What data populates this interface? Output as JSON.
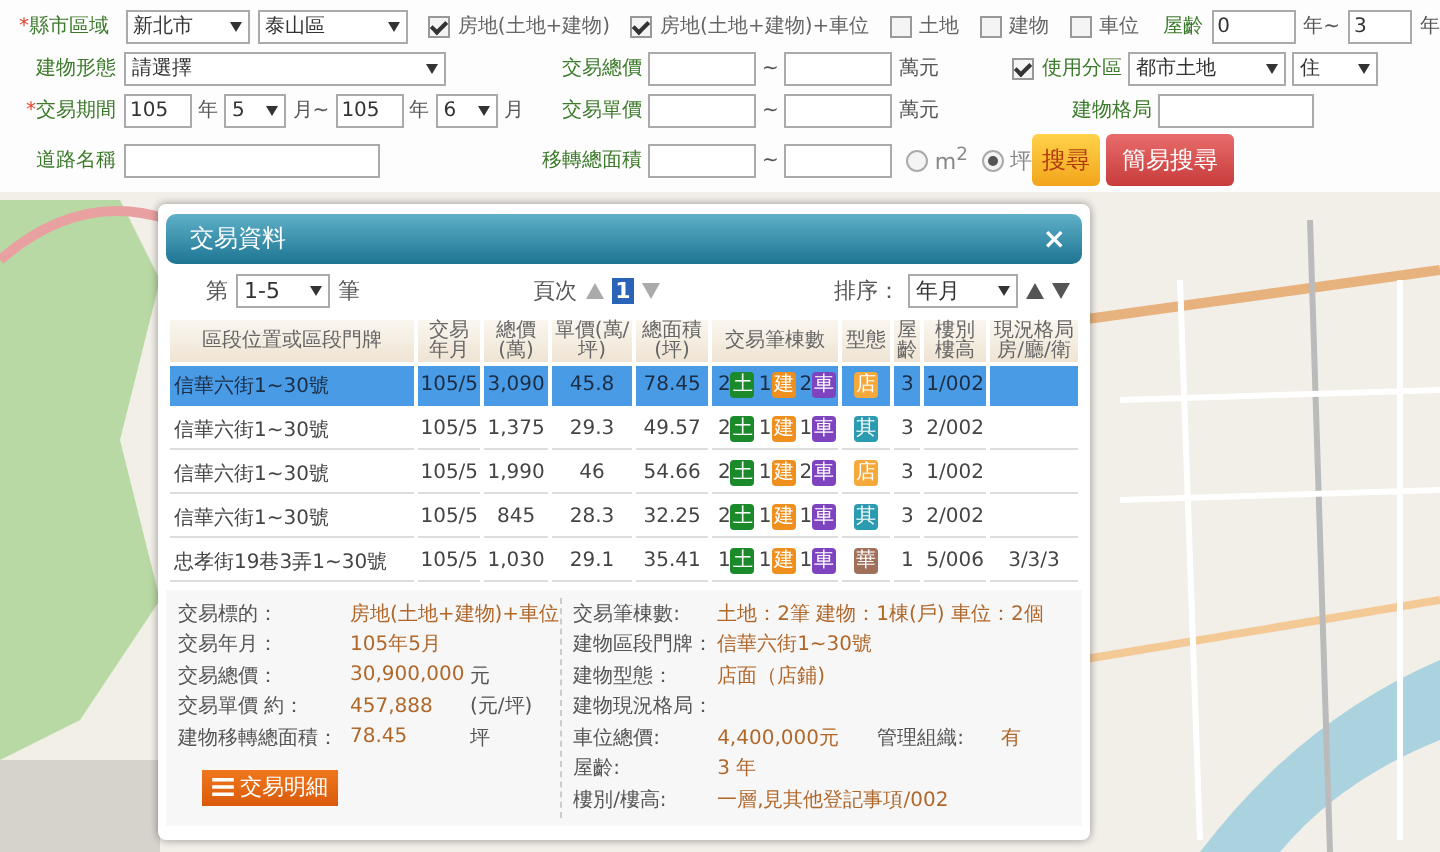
{
  "search_form": {
    "city": {
      "mark": "*",
      "label": "縣市區域",
      "county": "新北市",
      "district": "泰山區"
    },
    "transaction_types": [
      {
        "label": "房地(土地+建物)",
        "checked": true
      },
      {
        "label": "房地(土地+建物)+車位",
        "checked": true
      },
      {
        "label": "土地",
        "checked": false
      },
      {
        "label": "建物",
        "checked": false
      },
      {
        "label": "車位",
        "checked": false
      }
    ],
    "building_age": {
      "label": "屋齡",
      "from": "0",
      "unit_from": "年~",
      "to": "3",
      "unit_to": "年"
    },
    "building_type": {
      "label": "建物形態",
      "value": "請選擇"
    },
    "period": {
      "mark": "*",
      "label": "交易期間",
      "from_year": "105",
      "from_year_unit": "年",
      "from_month": "5",
      "from_month_unit": "月~",
      "to_year": "105",
      "to_year_unit": "年",
      "to_month": "6",
      "to_month_unit": "月"
    },
    "road": {
      "label": "道路名稱"
    },
    "total_price": {
      "label": "交易總價",
      "separator": "~",
      "unit": "萬元"
    },
    "unit_price": {
      "label": "交易單價",
      "separator": "~",
      "unit": "萬元"
    },
    "total_area": {
      "label": "移轉總面積",
      "separator": "~"
    },
    "area_units": [
      {
        "label": "m$^{2}$",
        "selected": false
      },
      {
        "label": "坪",
        "selected": true
      }
    ],
    "zoning": {
      "label": "使用分區",
      "checked": true,
      "value": "都市土地",
      "sub_value": "住"
    },
    "layout": {
      "label": "建物格局"
    },
    "buttons": [
      {
        "label": "搜尋",
        "kind": "primary"
      },
      {
        "label": "簡易搜尋",
        "kind": "secondary"
      }
    ]
  },
  "dialog": {
    "title": "交易資料",
    "close": "×",
    "range_prefix": "第",
    "range": "1-5",
    "range_suffix": "筆",
    "page_label": "頁次",
    "pages": [
      {
        "label": "1",
        "selected": true
      }
    ],
    "sort_label": "排序：",
    "sort": "年月",
    "columns": [
      "區段位置或區段門牌",
      "交易年月",
      "總價(萬)",
      "單價(萬/坪)",
      "總面積(坪)",
      "交易筆棟數",
      "型態",
      "屋齡",
      "樓別樓高",
      "現況格局房/廳/衛"
    ],
    "rows": [
      {
        "selected": true,
        "address": "信華六街1~30號",
        "date": "105/5",
        "total": "3,090",
        "unit_price": "45.8",
        "area": "78.45",
        "counts": [
          {
            "count": "2",
            "label": "土",
            "color": "#1b8a2a"
          },
          {
            "count": "1",
            "label": "建",
            "color": "#ee8f1e"
          },
          {
            "count": "2",
            "label": "車",
            "color": "#7e44c0"
          }
        ],
        "type": {
          "label": "店",
          "color": "#f4a93a"
        },
        "age": "3",
        "floor": "1/002"
      },
      {
        "selected": false,
        "address": "信華六街1~30號",
        "date": "105/5",
        "total": "1,375",
        "unit_price": "29.3",
        "area": "49.57",
        "counts": [
          {
            "count": "2",
            "label": "土",
            "color": "#1b8a2a"
          },
          {
            "count": "1",
            "label": "建",
            "color": "#ee8f1e"
          },
          {
            "count": "1",
            "label": "車",
            "color": "#7e44c0"
          }
        ],
        "type": {
          "label": "其",
          "color": "#2a9bb0"
        },
        "age": "3",
        "floor": "2/002"
      },
      {
        "selected": false,
        "address": "信華六街1~30號",
        "date": "105/5",
        "total": "1,990",
        "unit_price": "46",
        "area": "54.66",
        "counts": [
          {
            "count": "2",
            "label": "土",
            "color": "#1b8a2a"
          },
          {
            "count": "1",
            "label": "建",
            "color": "#ee8f1e"
          },
          {
            "count": "2",
            "label": "車",
            "color": "#7e44c0"
          }
        ],
        "type": {
          "label": "店",
          "color": "#f4a93a"
        },
        "age": "3",
        "floor": "1/002"
      },
      {
        "selected": false,
        "address": "信華六街1~30號",
        "date": "105/5",
        "total": "845",
        "unit_price": "28.3",
        "area": "32.25",
        "counts": [
          {
            "count": "2",
            "label": "土",
            "color": "#1b8a2a"
          },
          {
            "count": "1",
            "label": "建",
            "color": "#ee8f1e"
          },
          {
            "count": "1",
            "label": "車",
            "color": "#7e44c0"
          }
        ],
        "type": {
          "label": "其",
          "color": "#2a9bb0"
        },
        "age": "3",
        "floor": "2/002"
      },
      {
        "selected": false,
        "address": "忠孝街19巷3弄1~30號",
        "date": "105/5",
        "total": "1,030",
        "unit_price": "29.1",
        "area": "35.41",
        "counts": [
          {
            "count": "1",
            "label": "土",
            "color": "#1b8a2a"
          },
          {
            "count": "1",
            "label": "建",
            "color": "#ee8f1e"
          },
          {
            "count": "1",
            "label": "車",
            "color": "#7e44c0"
          }
        ],
        "type": {
          "label": "華",
          "color": "#a0705a"
        },
        "age": "1",
        "floor": "5/006",
        "layout": "3/3/3"
      }
    ],
    "details_left": [
      {
        "label": "交易標的：",
        "value": "房地(土地+建物)+車位"
      },
      {
        "label": "交易年月：",
        "value": "105年5月"
      },
      {
        "label": "交易總價：",
        "value": "30,900,000",
        "unit": "元"
      },
      {
        "label": "交易單價 約：",
        "value": "457,888",
        "unit": "(元/坪)"
      },
      {
        "label": "建物移轉總面積：",
        "value": "78.45",
        "unit": "坪"
      }
    ],
    "details_right": [
      {
        "label": "交易筆棟數:",
        "value": "土地：2筆 建物：1棟(戶) 車位：2個"
      },
      {
        "label": "建物區段門牌：",
        "value": "信華六街1~30號"
      },
      {
        "label": "建物型態：",
        "value": "店面（店鋪)"
      },
      {
        "label": "建物現況格局："
      },
      {
        "label": "車位總價:",
        "value": "4,400,000元",
        "extra_label": "管理組織:",
        "extra_value": "有"
      },
      {
        "label": "屋齡:",
        "value": "3 年"
      },
      {
        "label": "樓別/樓高:",
        "value": "一層,見其他登記事項/002"
      }
    ],
    "detail_button": "交易明細"
  }
}
